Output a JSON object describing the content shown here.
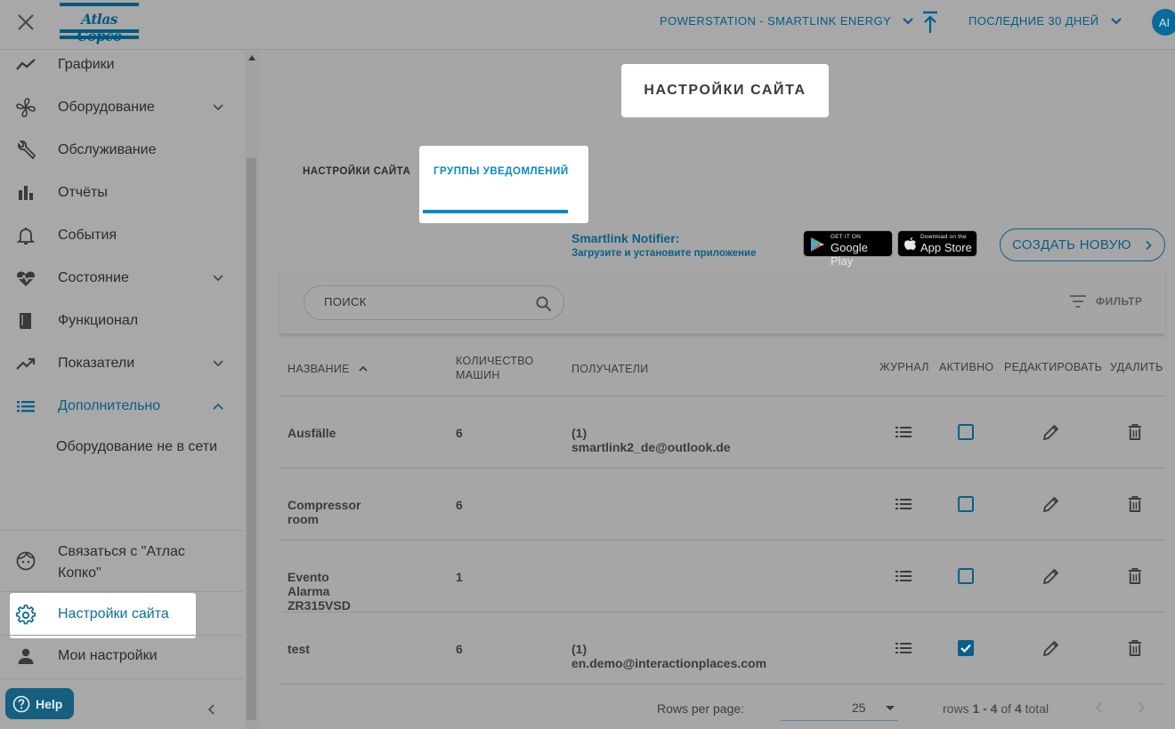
{
  "header": {
    "logo_text": "Atlas Copco",
    "site_selector": "POWERSTATION - SMARTLINK ENERGY",
    "period_selector": "ПОСЛЕДНИЕ 30 ДНЕЙ",
    "avatar_initials": "AI"
  },
  "sidebar": {
    "items": [
      {
        "label": "Графики",
        "icon": "line-chart-icon"
      },
      {
        "label": "Оборудование",
        "icon": "fan-icon",
        "expandable": true
      },
      {
        "label": "Обслуживание",
        "icon": "wrench-icon"
      },
      {
        "label": "Отчёты",
        "icon": "bar-chart-icon"
      },
      {
        "label": "События",
        "icon": "bell-icon"
      },
      {
        "label": "Состояние",
        "icon": "heart-pulse-icon",
        "expandable": true
      },
      {
        "label": "Функционал",
        "icon": "book-icon"
      },
      {
        "label": "Показатели",
        "icon": "trend-up-icon",
        "expandable": true
      },
      {
        "label": "Дополнительно",
        "icon": "list-icon",
        "expandable": true,
        "expanded": true,
        "active": true
      }
    ],
    "sub_item": "Оборудование не в сети",
    "contact_label": "Связаться с \"Атлас Копко\"",
    "contact_line1": "Связаться с \"Атлас",
    "contact_line2": "Копко\"",
    "site_settings_label": "Настройки сайта",
    "my_settings_label": "Мои настройки",
    "help_label": "Help"
  },
  "main": {
    "page_title": "НАСТРОЙКИ САЙТА",
    "tabs": [
      {
        "label": "НАСТРОЙКИ САЙТА",
        "active": false
      },
      {
        "label": "ГРУППЫ УВЕДОМЛЕНИЙ",
        "active": true
      }
    ],
    "notifier_title": "Smartlink Notifier:",
    "notifier_subtitle": "Загрузите и установите приложение",
    "google_play_small": "GET IT ON",
    "google_play_big": "Google Play",
    "app_store_small": "Download on the",
    "app_store_big": "App Store",
    "create_button": "СОЗДАТЬ НОВУЮ",
    "search_placeholder": "ПОИСК",
    "filter_label": "ФИЛЬТР",
    "columns": {
      "name": "НАЗВАНИЕ",
      "machines_line1": "КОЛИЧЕСТВО",
      "machines_line2": "МАШИН",
      "recipients": "ПОЛУЧАТЕЛИ",
      "journal": "ЖУРНАЛ",
      "active": "АКТИВНО",
      "edit": "РЕДАКТИРОВАТЬ",
      "delete": "УДАЛИТЬ"
    },
    "rows": [
      {
        "name": "Ausfälle",
        "machines": "6",
        "recipients": "(1) smartlink2_de@outlook.de",
        "active": false
      },
      {
        "name": "Compressor room",
        "machines": "6",
        "recipients": "",
        "active": false
      },
      {
        "name": "Evento Alarma ZR315VSD",
        "machines": "1",
        "recipients": "",
        "active": false
      },
      {
        "name": "test",
        "machines": "6",
        "recipients": "(1) en.demo@interactionplaces.com",
        "active": true
      }
    ],
    "pagination": {
      "rows_per_page_label": "Rows per page:",
      "rows_per_page": "25",
      "range_prefix": "rows ",
      "range_from_to": "1 - 4",
      "range_of": " of ",
      "range_total": "4",
      "range_suffix": " total"
    }
  },
  "colors": {
    "accent": "#0a8ac6",
    "brand": "#005a80",
    "overlay_bg": "#a8a8a8"
  }
}
